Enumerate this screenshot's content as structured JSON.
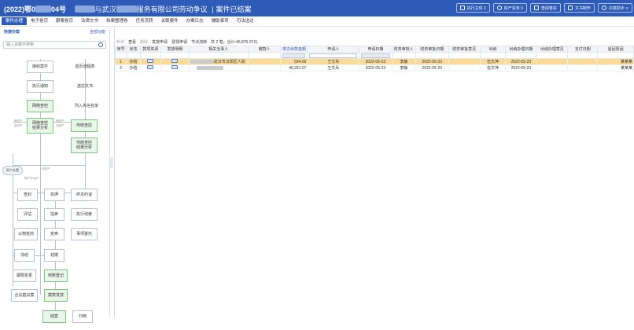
{
  "header": {
    "case_no_prefix": "(2022)鄂0",
    "case_no_suffix": "04号",
    "title_mid": "与武汉",
    "title_tail": "服务有限公司劳动争议",
    "title_sep": "|",
    "title_status": "案件已结案",
    "buttons": [
      {
        "label": "执行主体 3",
        "icon": "person-icon"
      },
      {
        "label": "财产清单 0",
        "icon": "shield-icon"
      },
      {
        "label": "查阅卷宗",
        "icon": "folder-icon"
      },
      {
        "label": "文书制作",
        "icon": "edit-icon"
      },
      {
        "label": "办案助手 ∨",
        "icon": "user-gear-icon"
      }
    ]
  },
  "tabs": [
    "案件办理",
    "电子卷宗",
    "跟案卷宗",
    "法律文书",
    "档案整理卷",
    "任务流转",
    "关联案件",
    "办案日志",
    "辅助事项",
    "司法送达"
  ],
  "sidebar": {
    "title": "快捷办案",
    "link": "全部功能",
    "search_placeholder": "输入关键字搜索",
    "flow": {
      "n1": "接收案件",
      "n2": "首页流程表",
      "n3": "执行通知",
      "n4": "送达文书",
      "n5": "网络查控",
      "n6": "列入失信名单",
      "n7a": "网络查控",
      "n7b": "结果分析",
      "n8": "传统查控",
      "n9a": "传统查控",
      "n9b": "结果分析",
      "s1": "有财产",
      "s2": "无财产",
      "s3": "有财产",
      "s4": "无财产",
      "d1": "财产处置",
      "s5": "无财产",
      "s6": "财产/不动产",
      "s7": "有财产",
      "n10": "查封",
      "n11": "扣押",
      "n12": "终本约谈",
      "n13": "评估",
      "n14": "拍卖",
      "n15": "执行线索",
      "n16": "以物抵债",
      "n17": "变卖",
      "n18": "事项委托",
      "n19": "冻结",
      "n20": "划拨",
      "n21": "期限变更",
      "n22": "到账登记",
      "n23": "合议庭议案",
      "n24": "案款发放",
      "n25": "结案",
      "n26": "归档"
    }
  },
  "toolbar": {
    "items": [
      "新增",
      "查看",
      "删除",
      "发放申请",
      "冒领申请",
      "节点流转"
    ],
    "summary": "共 2 笔，合计:46,875.07元"
  },
  "table": {
    "headers": [
      "序号",
      "状态",
      "款项来源",
      "发放明细",
      "相关当事人",
      "被款人",
      "单次余款金额",
      "申请人",
      "申请日期",
      "财务审核人",
      "财务审批日期",
      "财务审批意见",
      "出纳",
      "出纳办理日期",
      "出纳办理意见",
      "支付日期",
      "退回原因"
    ],
    "rows": [
      {
        "no": "1",
        "status": "办结",
        "party_tail": "武汉市汉阳区人民",
        "amount": "594.00",
        "applicant": "王文兵",
        "apply_date": "2022-05-23",
        "reviewer": "李静",
        "review_date": "2022-05-23",
        "cashier": "伍文萍",
        "cashier_date": "2022-05-23",
        "tail": "某某某"
      },
      {
        "no": "2",
        "status": "办结",
        "party_tail": "",
        "amount": "46,281.07",
        "applicant": "王文兵",
        "apply_date": "2022-05-23",
        "reviewer": "李静",
        "review_date": "2022-05-23",
        "cashier": "伍文萍",
        "cashier_date": "2022-05-23",
        "tail": "某某某"
      }
    ]
  },
  "colors": {
    "brand": "#2f5bb8",
    "selected_row": "#fbdc97",
    "flow_green": "#eaf6ea"
  }
}
